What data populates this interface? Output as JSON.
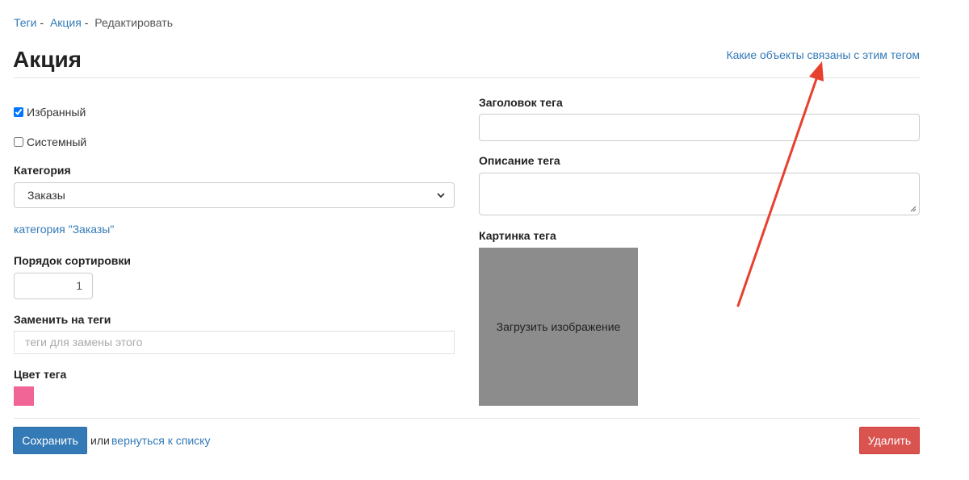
{
  "breadcrumb": {
    "items": [
      "Теги",
      "Акция"
    ],
    "separator": "-",
    "current": "Редактировать"
  },
  "page_title": "Акция",
  "related_link": "Какие объекты связаны с этим тегом",
  "form": {
    "favorite": {
      "label": "Избранный",
      "checked": true
    },
    "system": {
      "label": "Системный",
      "checked": false
    },
    "category": {
      "label": "Категория",
      "value": "Заказы",
      "link": "категория \"Заказы\""
    },
    "sort_order": {
      "label": "Порядок сортировки",
      "value": "1"
    },
    "replace_tags": {
      "label": "Заменить на теги",
      "placeholder": "теги для замены этого"
    },
    "tag_color": {
      "label": "Цвет тега",
      "value": "#f06595"
    },
    "tag_heading": {
      "label": "Заголовок тега",
      "value": ""
    },
    "tag_description": {
      "label": "Описание тега",
      "value": ""
    },
    "tag_image": {
      "label": "Картинка тега",
      "upload_text": "Загрузить изображение"
    }
  },
  "actions": {
    "save": "Сохранить",
    "or": "или",
    "back": "вернуться к списку",
    "delete": "Удалить"
  },
  "colors": {
    "link": "#337ab7",
    "primary": "#337ab7",
    "danger": "#d9534f",
    "annotation_arrow": "#e8402f"
  }
}
